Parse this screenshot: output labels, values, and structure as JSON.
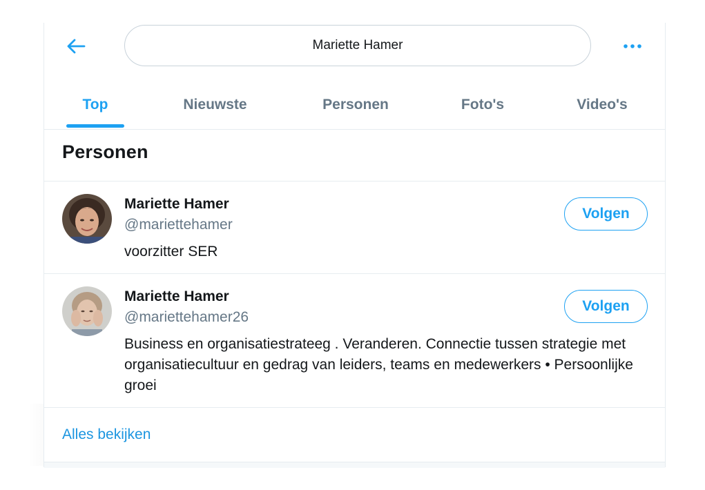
{
  "search": {
    "query": "Mariette Hamer"
  },
  "tabs": [
    {
      "label": "Top",
      "active": true
    },
    {
      "label": "Nieuwste",
      "active": false
    },
    {
      "label": "Personen",
      "active": false
    },
    {
      "label": "Foto's",
      "active": false
    },
    {
      "label": "Video's",
      "active": false
    }
  ],
  "section": {
    "title": "Personen"
  },
  "people": [
    {
      "name": "Mariette Hamer",
      "handle": "@mariettehamer",
      "bio": "voorzitter SER",
      "button": "Volgen"
    },
    {
      "name": "Mariette Hamer",
      "handle": "@mariettehamer26",
      "bio": "Business en organisatiestrateeg . Veranderen. Connectie tussen strategie met organisatiecultuur en gedrag van leiders, teams en medewerkers • Persoonlijke groei",
      "button": "Volgen"
    }
  ],
  "footer": {
    "see_all": "Alles bekijken"
  },
  "icons": {
    "back": "arrow-left-icon",
    "more": "more-horizontal-icon"
  },
  "colors": {
    "accent": "#1da1f2",
    "text_primary": "#14171a",
    "text_secondary": "#657786",
    "border": "#e6ecf0"
  }
}
